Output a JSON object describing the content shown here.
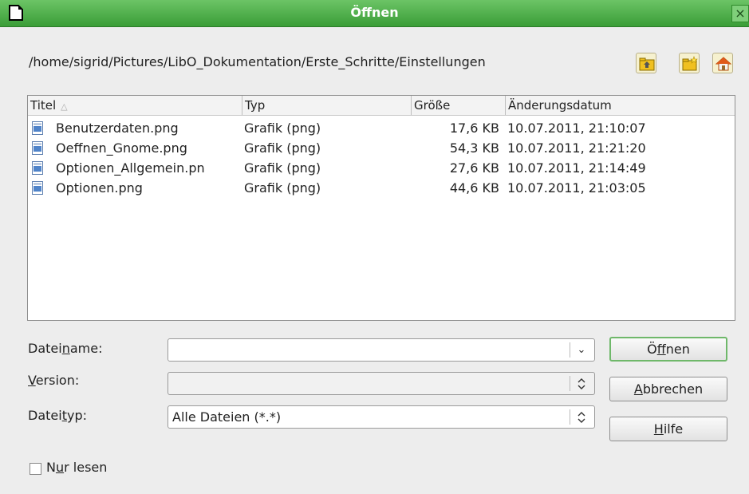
{
  "window": {
    "title": "Öffnen",
    "close_glyph": "×"
  },
  "path": "/home/sigrid/Pictures/LibO_Dokumentation/Erste_Schritte/Einstellungen",
  "toolbar": [
    {
      "icon": "folder-up-icon"
    },
    {
      "icon": "new-folder-icon"
    },
    {
      "icon": "home-icon"
    }
  ],
  "filelist": {
    "columns": {
      "name": "Titel",
      "sort_glyph": "△",
      "type": "Typ",
      "size": "Größe",
      "date": "Änderungsdatum"
    },
    "rows": [
      {
        "name": "Benutzerdaten.png",
        "type": "Grafik (png)",
        "size": "17,6 KB",
        "date": "10.07.2011, 21:10:07"
      },
      {
        "name": "Oeffnen_Gnome.png",
        "type": "Grafik (png)",
        "size": "54,3 KB",
        "date": "10.07.2011, 21:21:20"
      },
      {
        "name": "Optionen_Allgemein.pn",
        "type": "Grafik (png)",
        "size": "27,6 KB",
        "date": "10.07.2011, 21:14:49"
      },
      {
        "name": "Optionen.png",
        "type": "Grafik (png)",
        "size": "44,6 KB",
        "date": "10.07.2011, 21:03:05"
      }
    ]
  },
  "form": {
    "filename": {
      "label_a": "Datei",
      "label_u": "n",
      "label_b": "ame:",
      "value": ""
    },
    "version": {
      "label_a": "",
      "label_u": "V",
      "label_b": "ersion:",
      "value": ""
    },
    "filetype": {
      "label_a": "Datei",
      "label_u": "t",
      "label_b": "yp:",
      "value": "Alle Dateien (*.*)"
    }
  },
  "buttons": {
    "open": {
      "a": "Ö",
      "u": "f",
      "b": "fnen"
    },
    "cancel": {
      "a": "",
      "u": "A",
      "b": "bbrechen"
    },
    "help": {
      "a": "",
      "u": "H",
      "b": "ilfe"
    }
  },
  "readonly": {
    "label_a": "N",
    "label_u": "u",
    "label_b": "r lesen",
    "checked": false
  },
  "colors": {
    "titlebar": "#4fb04a",
    "accent_border": "#6fb86a",
    "folder_icon": "#f0c020",
    "home_icon_roof": "#e05a1a"
  }
}
